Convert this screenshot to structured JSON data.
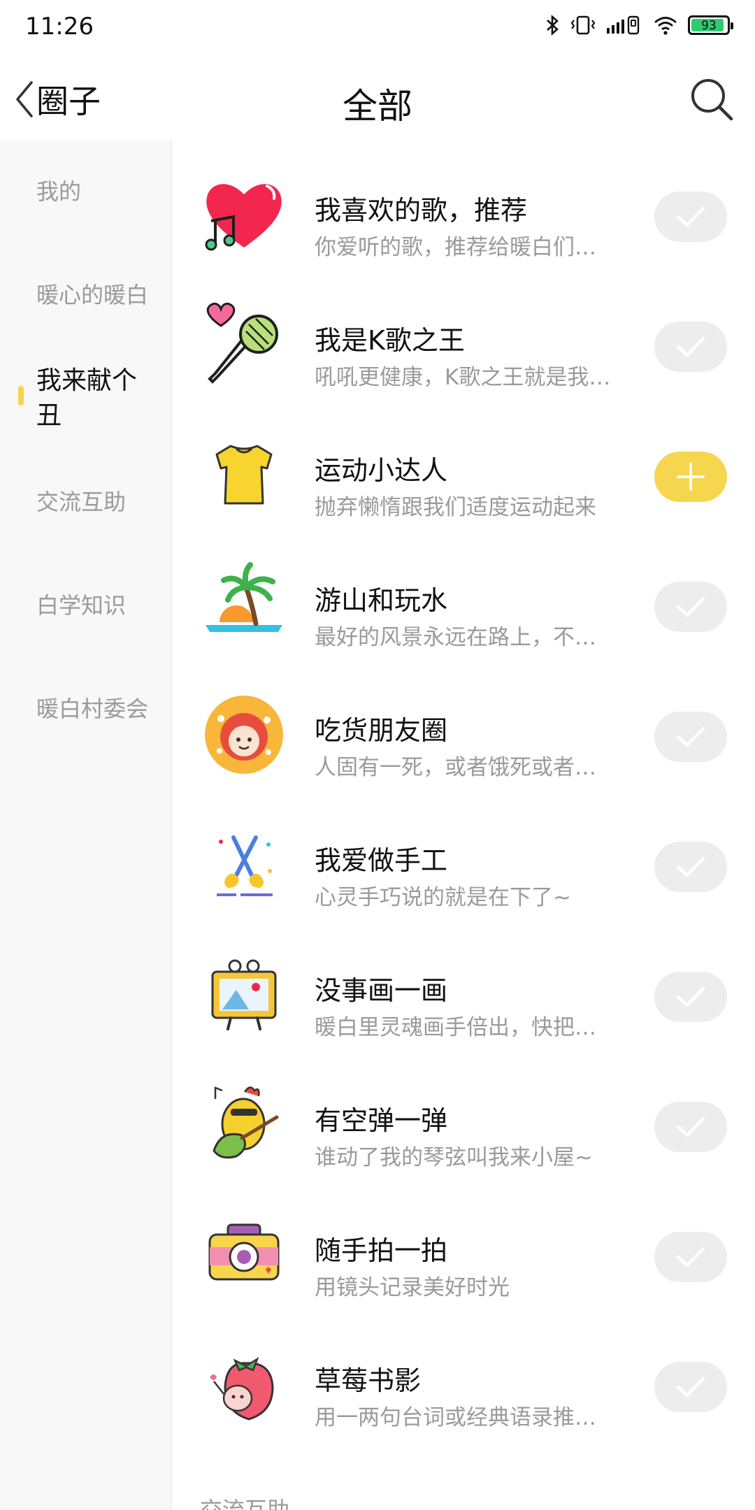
{
  "status_bar": {
    "time": "11:26",
    "battery": "93",
    "battery_level": 0.93
  },
  "header": {
    "back_label": "圈子",
    "title": "全部"
  },
  "sidebar": {
    "items": [
      {
        "label": "我的",
        "active": false
      },
      {
        "label": "暖心的暖白",
        "active": false
      },
      {
        "label": "我来献个丑",
        "active": true
      },
      {
        "label": "交流互助",
        "active": false
      },
      {
        "label": "白学知识",
        "active": false
      },
      {
        "label": "暖白村委会",
        "active": false
      }
    ]
  },
  "circles": [
    {
      "icon": "heart-music-icon",
      "title": "我喜欢的歌，推荐",
      "subtitle": "你爱听的歌，推荐给暖白们也听听吧",
      "state": "joined"
    },
    {
      "icon": "microphone-icon",
      "title": "我是K歌之王",
      "subtitle": "吼吼更健康，K歌之王就是我你不服",
      "state": "joined"
    },
    {
      "icon": "tshirt-icon",
      "title": "运动小达人",
      "subtitle": "抛弃懒惰跟我们适度运动起来",
      "state": "join"
    },
    {
      "icon": "palm-island-icon",
      "title": "游山和玩水",
      "subtitle": "最好的风景永远在路上，不论去哪里",
      "state": "joined"
    },
    {
      "icon": "foodie-icon",
      "title": "吃货朋友圈",
      "subtitle": "人固有一死，或者饿死或者撑死",
      "state": "joined"
    },
    {
      "icon": "scissors-icon",
      "title": "我爱做手工",
      "subtitle": "心灵手巧说的就是在下了~",
      "state": "joined"
    },
    {
      "icon": "drawing-board-icon",
      "title": "没事画一画",
      "subtitle": "暖白里灵魂画手倍出，快把你的画晒出来",
      "state": "joined"
    },
    {
      "icon": "guitar-chicken-icon",
      "title": "有空弹一弹",
      "subtitle": "谁动了我的琴弦叫我来小屋~",
      "state": "joined"
    },
    {
      "icon": "camera-icon",
      "title": "随手拍一拍",
      "subtitle": "用镜头记录美好时光",
      "state": "joined"
    },
    {
      "icon": "strawberry-icon",
      "title": "草莓书影",
      "subtitle": "用一两句台词或经典语录推荐好书好影",
      "state": "joined"
    }
  ],
  "section_label": "交流互助",
  "colors": {
    "accent": "#f6d64e",
    "inactive_text": "#9a9a9a",
    "joined_button": "#ededed"
  }
}
